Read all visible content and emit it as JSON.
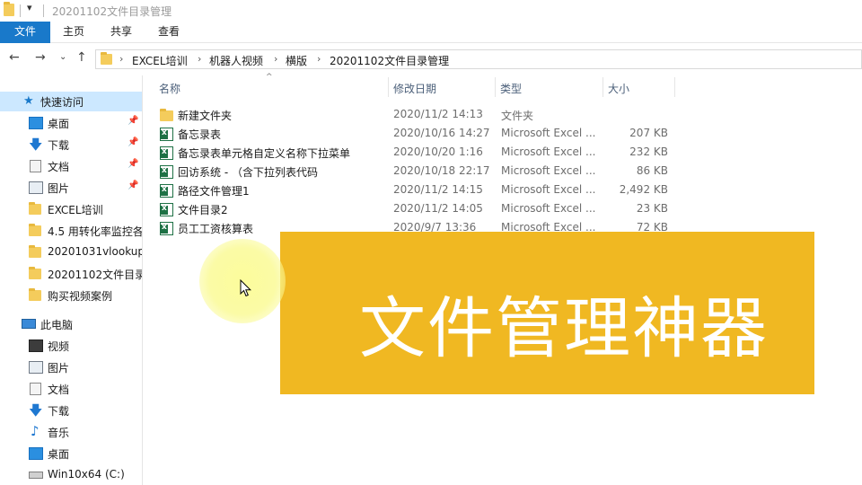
{
  "window": {
    "title": "20201102文件目录管理"
  },
  "ribbon": {
    "tabs": [
      "文件",
      "主页",
      "共享",
      "查看"
    ]
  },
  "address": {
    "crumbs": [
      "EXCEL培训",
      "机器人视频",
      "横版",
      "20201102文件目录管理"
    ]
  },
  "nav": {
    "quick_access": "快速访问",
    "quick_items": [
      "桌面",
      "下载",
      "文档",
      "图片",
      "EXCEL培训",
      "4.5 用转化率监控各",
      "20201031vlookup",
      "20201102文件目录",
      "购买视频案例"
    ],
    "this_pc": "此电脑",
    "pc_items": [
      "视频",
      "图片",
      "文档",
      "下载",
      "音乐",
      "桌面",
      "Win10x64 (C:)"
    ]
  },
  "columns": {
    "name": "名称",
    "date": "修改日期",
    "type": "类型",
    "size": "大小"
  },
  "files": [
    {
      "name": "新建文件夹",
      "date": "2020/11/2 14:13",
      "type": "文件夹",
      "size": "",
      "icon": "folder-icon"
    },
    {
      "name": "备忘录表",
      "date": "2020/10/16 14:27",
      "type": "Microsoft Excel ...",
      "size": "207 KB",
      "icon": "excel-icon"
    },
    {
      "name": "备忘录表单元格自定义名称下拉菜单",
      "date": "2020/10/20 1:16",
      "type": "Microsoft Excel ...",
      "size": "232 KB",
      "icon": "excel-icon"
    },
    {
      "name": "回访系统 - （含下拉列表代码",
      "date": "2020/10/18 22:17",
      "type": "Microsoft Excel ...",
      "size": "86 KB",
      "icon": "excel-icon"
    },
    {
      "name": "路径文件管理1",
      "date": "2020/11/2 14:15",
      "type": "Microsoft Excel ...",
      "size": "2,492 KB",
      "icon": "excel-icon"
    },
    {
      "name": "文件目录2",
      "date": "2020/11/2 14:05",
      "type": "Microsoft Excel ...",
      "size": "23 KB",
      "icon": "excel-icon"
    },
    {
      "name": "员工工资核算表",
      "date": "2020/9/7 13:36",
      "type": "Microsoft Excel ...",
      "size": "72 KB",
      "icon": "excel-icon"
    }
  ],
  "overlay": {
    "text": "文件管理神器"
  },
  "colors": {
    "accent": "#1979ca",
    "overlay": "#f0b822",
    "selection": "#cce8ff"
  }
}
